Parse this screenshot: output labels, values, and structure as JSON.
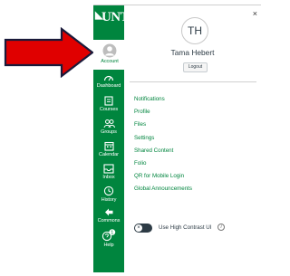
{
  "colors": {
    "nav_bg": "#00853e",
    "link": "#00853e",
    "text": "#2d3b45",
    "arrow": "#e00000",
    "arrow_outline": "#1a1a3a"
  },
  "nav": {
    "logo": "UNT",
    "items": [
      {
        "label": "Account",
        "icon": "account-avatar-icon"
      },
      {
        "label": "Dashboard",
        "icon": "dashboard-icon"
      },
      {
        "label": "Courses",
        "icon": "courses-icon"
      },
      {
        "label": "Groups",
        "icon": "groups-icon"
      },
      {
        "label": "Calendar",
        "icon": "calendar-icon"
      },
      {
        "label": "Inbox",
        "icon": "inbox-icon"
      },
      {
        "label": "History",
        "icon": "history-icon"
      },
      {
        "label": "Commons",
        "icon": "commons-icon"
      },
      {
        "label": "Help",
        "icon": "help-icon"
      }
    ],
    "help_badge": "1"
  },
  "tray": {
    "close": "×",
    "avatar_initials": "TH",
    "user_name": "Tama Hebert",
    "logout_label": "Logout",
    "links": [
      "Notifications",
      "Profile",
      "Files",
      "Settings",
      "Shared Content",
      "Folio",
      "QR for Mobile Login",
      "Global Announcements"
    ],
    "high_contrast": {
      "label": "Use High Contrast UI",
      "enabled": false,
      "info": "i"
    }
  }
}
